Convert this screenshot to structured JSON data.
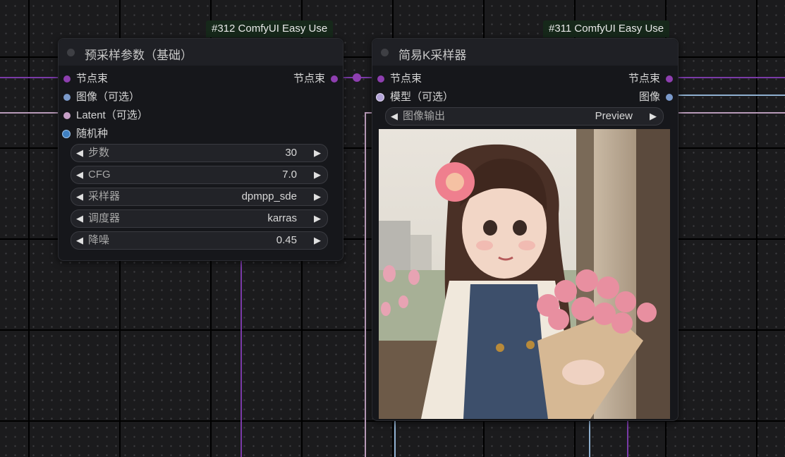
{
  "node_312": {
    "badge": "#312 ComfyUI Easy Use",
    "title": "预采样参数（基础）",
    "inputs": [
      {
        "label": "节点束",
        "color": "#8e3fb0"
      },
      {
        "label": "图像（可选）",
        "color": "#7b9acb"
      },
      {
        "label": "Latent（可选）",
        "color": "#c6a0c6"
      },
      {
        "label": "随机种",
        "color": "#3f7fc0"
      }
    ],
    "output": {
      "label": "节点束",
      "color": "#8e3fb0"
    },
    "widgets": [
      {
        "label": "步数",
        "value": "30"
      },
      {
        "label": "CFG",
        "value": "7.0"
      },
      {
        "label": "采样器",
        "value": "dpmpp_sde"
      },
      {
        "label": "调度器",
        "value": "karras"
      },
      {
        "label": "降噪",
        "value": "0.45"
      }
    ]
  },
  "node_311": {
    "badge": "#311 ComfyUI Easy Use",
    "title": "简易K采样器",
    "inputs": [
      {
        "label": "节点束",
        "color": "#8e3fb0"
      },
      {
        "label": "模型（可选）",
        "color": "#b3a4d8"
      }
    ],
    "outputs": [
      {
        "label": "节点束",
        "color": "#8e3fb0"
      },
      {
        "label": "图像",
        "color": "#7b9acb"
      }
    ],
    "widget": {
      "label": "图像输出",
      "value": "Preview"
    }
  },
  "arrows": {
    "left": "◀",
    "right": "▶"
  },
  "colors": {
    "wire_purple": "#7a3aa8",
    "wire_pink": "#b89ab8",
    "wire_blue": "#8fb0d0",
    "badge_bg": "#16281a"
  }
}
